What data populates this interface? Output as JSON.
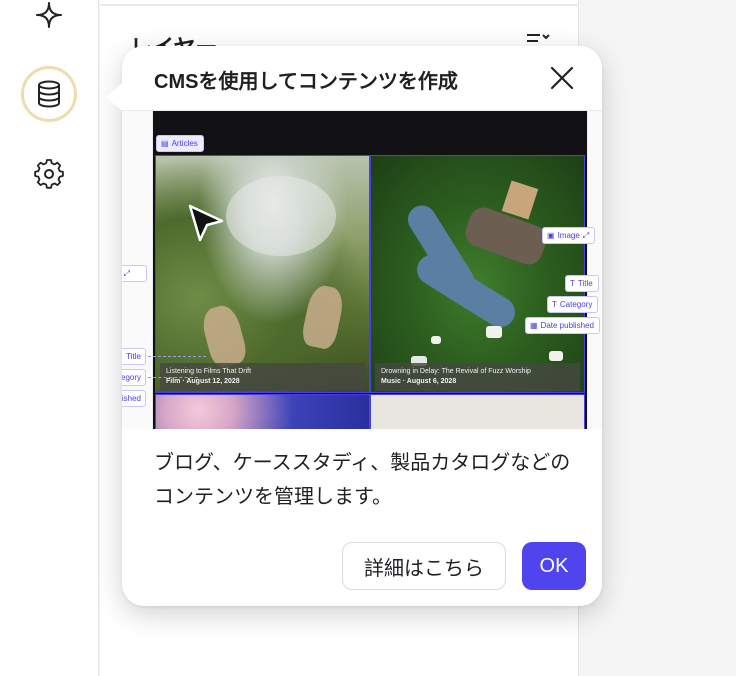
{
  "rail": {
    "icons": [
      "sparkle-icon",
      "database-icon",
      "gear-icon"
    ]
  },
  "panel": {
    "title": "レイヤー"
  },
  "popover": {
    "title": "CMSを使用してコンテンツを作成",
    "description": "ブログ、ケーススタディ、製品カタログなどのコンテンツを管理します。",
    "learn_more_label": "詳細はこちら",
    "ok_label": "OK"
  },
  "illustration": {
    "collection_chip": "Articles",
    "image_chip": "Image",
    "left_chips": {
      "image": "e",
      "title": "Title",
      "category": "tegory",
      "date": "ished"
    },
    "right_chips": {
      "title": "Title",
      "category": "Category",
      "date": "Date published"
    },
    "cards": [
      {
        "title": "Listening to Films That Drift",
        "meta": "Film · August 12, 2028"
      },
      {
        "title": "Drowning in Delay: The Revival of Fuzz Worship",
        "meta": "Music · August 6, 2028"
      }
    ]
  },
  "colors": {
    "accent": "#4f44ee",
    "selection": "#4b40e0",
    "active_ring": "#efdcae"
  }
}
